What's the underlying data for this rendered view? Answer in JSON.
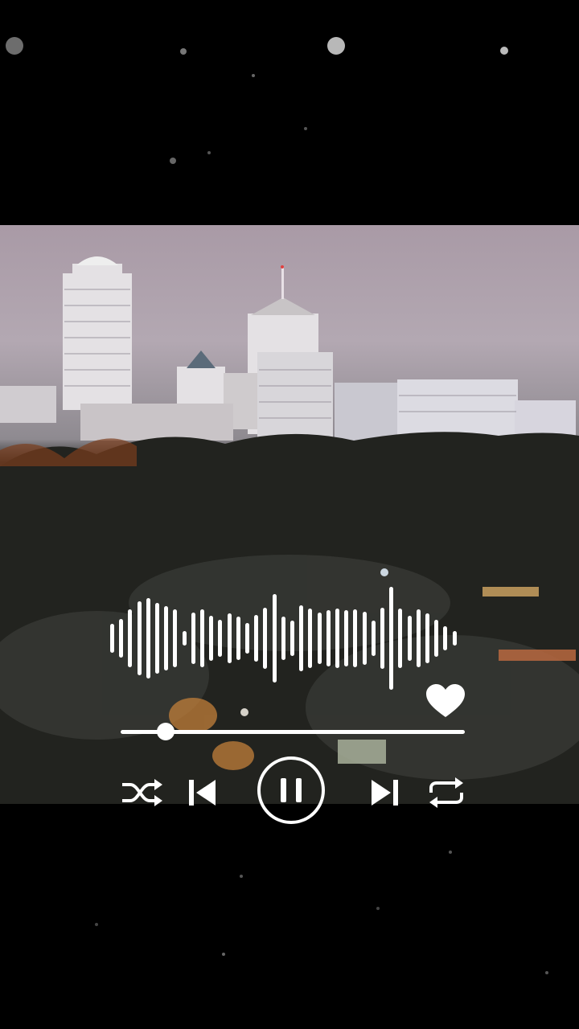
{
  "player": {
    "controls": [
      "shuffle",
      "previous",
      "pause",
      "next",
      "repeat"
    ],
    "liked": true,
    "progress_fraction": 0.13,
    "state": "playing"
  },
  "waveform": {
    "levels": [
      0.28,
      0.38,
      0.56,
      0.72,
      0.78,
      0.68,
      0.62,
      0.56,
      0.14,
      0.5,
      0.56,
      0.44,
      0.36,
      0.48,
      0.42,
      0.3,
      0.46,
      0.6,
      0.86,
      0.42,
      0.34,
      0.64,
      0.58,
      0.5,
      0.54,
      0.58,
      0.55,
      0.56,
      0.52,
      0.34,
      0.6,
      1.0,
      0.58,
      0.44,
      0.56,
      0.48,
      0.36,
      0.24,
      0.14
    ]
  },
  "colors": {
    "accent": "#ffffff",
    "background": "#000000"
  },
  "icons": {
    "shuffle": "shuffle-icon",
    "previous": "skip-previous-icon",
    "pause": "pause-icon",
    "next": "skip-next-icon",
    "repeat": "repeat-icon",
    "like": "heart-icon"
  }
}
